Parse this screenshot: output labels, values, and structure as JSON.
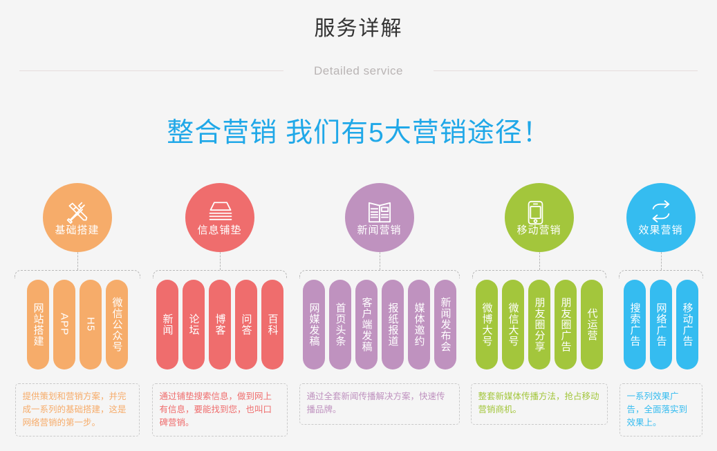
{
  "header": {
    "title": "服务详解",
    "subtitle": "Detailed service",
    "main_heading": "整合营销 我们有5大营销途径！"
  },
  "colors": {
    "heading_blue": "#20a8e8",
    "orange": "#f6ac6a",
    "red": "#ef6d6d",
    "purple": "#bf92bf",
    "green": "#a3c63c",
    "blue": "#35bcf0"
  },
  "columns": [
    {
      "id": "basic-build",
      "color": "#f6ac6a",
      "icon": "wrench-screwdriver-icon",
      "circle_label": "基础搭建",
      "pills": [
        {
          "label": "网站搭建",
          "vertical": true
        },
        {
          "label": "APP",
          "vertical": false
        },
        {
          "label": "H5",
          "vertical": false
        },
        {
          "label": "微信公众号",
          "vertical": true
        }
      ],
      "description": "提供策划和营销方案，并完成一系列的基础搭建，这是网络营销的第一步。"
    },
    {
      "id": "info-bedding",
      "color": "#ef6d6d",
      "icon": "stacked-layers-icon",
      "circle_label": "信息铺垫",
      "pills": [
        {
          "label": "新闻",
          "vertical": true
        },
        {
          "label": "论坛",
          "vertical": true
        },
        {
          "label": "博客",
          "vertical": true
        },
        {
          "label": "问答",
          "vertical": true
        },
        {
          "label": "百科",
          "vertical": true
        }
      ],
      "description": "通过铺垫搜索信息，做到网上有信息，要能找到您，也叫口碑营销。"
    },
    {
      "id": "news-marketing",
      "color": "#bf92bf",
      "icon": "newspaper-icon",
      "circle_label": "新闻营销",
      "pills": [
        {
          "label": "网媒发稿",
          "vertical": true
        },
        {
          "label": "首页头条",
          "vertical": true
        },
        {
          "label": "客户端发稿",
          "vertical": true
        },
        {
          "label": "报纸报道",
          "vertical": true
        },
        {
          "label": "媒体邀约",
          "vertical": true
        },
        {
          "label": "新闻发布会",
          "vertical": true
        }
      ],
      "description": "通过全套新闻传播解决方案，快速传播品牌。"
    },
    {
      "id": "mobile-marketing",
      "color": "#a3c63c",
      "icon": "smartphone-icon",
      "circle_label": "移动营销",
      "pills": [
        {
          "label": "微博大号",
          "vertical": true
        },
        {
          "label": "微信大号",
          "vertical": true
        },
        {
          "label": "朋友圈分享",
          "vertical": true
        },
        {
          "label": "朋友圈广告",
          "vertical": true
        },
        {
          "label": "代运营",
          "vertical": true
        }
      ],
      "description": "整套新媒体传播方法，抢占移动营销商机。"
    },
    {
      "id": "performance-marketing",
      "color": "#35bcf0",
      "icon": "refresh-cycle-icon",
      "circle_label": "效果营销",
      "pills": [
        {
          "label": "搜索广告",
          "vertical": true
        },
        {
          "label": "网络广告",
          "vertical": true
        },
        {
          "label": "移动广告",
          "vertical": true
        }
      ],
      "description": "一系列效果广告，全面落实到效果上。"
    }
  ]
}
